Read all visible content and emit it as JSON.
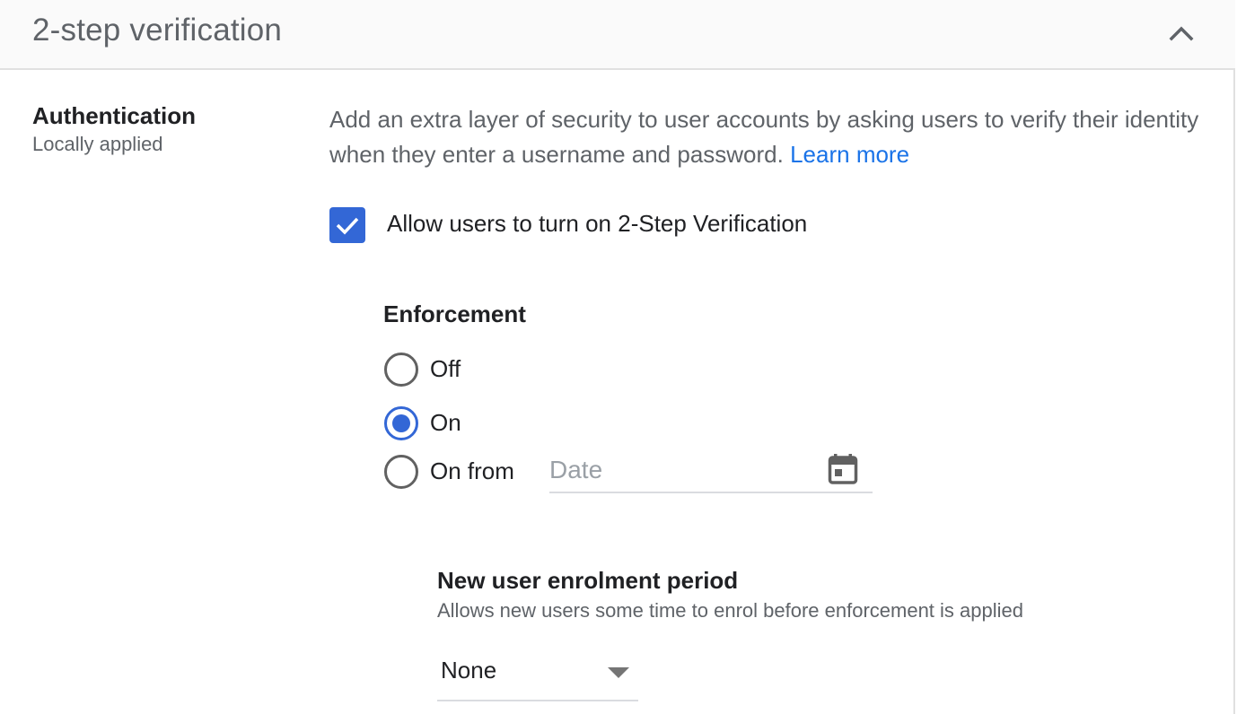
{
  "header": {
    "title": "2-step verification",
    "collapse_icon": "chevron-up-icon"
  },
  "section": {
    "label": "Authentication",
    "sublabel": "Locally applied",
    "description": "Add an extra layer of security to user accounts by asking users to verify their identity when they enter a username and password.",
    "learn_more": "Learn more"
  },
  "allow_checkbox": {
    "label": "Allow users to turn on 2-Step Verification",
    "checked": true,
    "color": "#3367d6"
  },
  "enforcement": {
    "title": "Enforcement",
    "options": [
      {
        "label": "Off",
        "selected": false
      },
      {
        "label": "On",
        "selected": true
      },
      {
        "label": "On from",
        "selected": false
      }
    ],
    "date_placeholder": "Date",
    "date_value": "",
    "calendar_icon": "calendar-icon"
  },
  "new_user_enrolment": {
    "title": "New user enrolment period",
    "subtitle": "Allows new users some time to enrol before enforcement is applied",
    "selected_value": "None"
  },
  "colors": {
    "accent": "#1a73e8",
    "primary": "#3367d6",
    "text": "#202124",
    "secondary_text": "#5f6368"
  }
}
